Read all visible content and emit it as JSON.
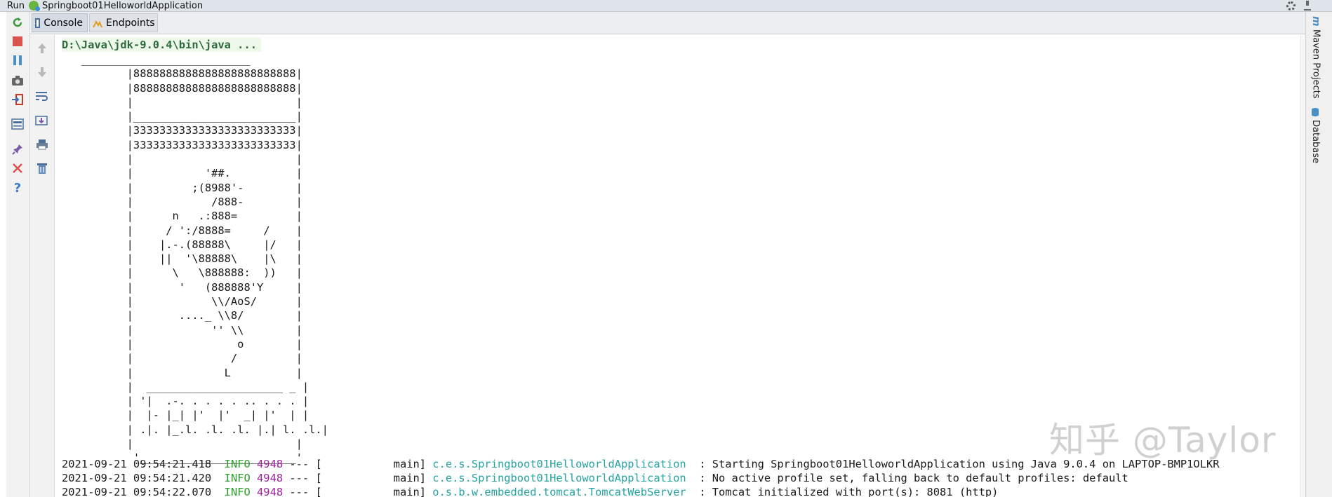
{
  "titlebar": {
    "run_label": "Run",
    "app_name": "Springboot01HelloworldApplication"
  },
  "tabs": [
    {
      "label": "Console",
      "icon": "console-icon",
      "active": true
    },
    {
      "label": "Endpoints",
      "icon": "endpoints-icon",
      "active": false
    }
  ],
  "left_toolbar": [
    "rerun-icon",
    "stop-icon",
    "pause-icon",
    "camera-icon",
    "exit-icon",
    "layout-icon",
    "pin-icon",
    "close-icon",
    "help-icon"
  ],
  "gutter_toolbar": [
    "up-arrow-icon",
    "down-arrow-icon",
    "soft-wrap-icon",
    "scroll-to-end-icon",
    "print-icon",
    "trash-icon"
  ],
  "right_bar": {
    "maven": "Maven Projects",
    "database": "Database"
  },
  "console": {
    "command": "D:\\Java\\jdk-9.0.4\\bin\\java ...",
    "banner": "   __________________________\n          |8888888888888888888888888|\n          |8888888888888888888888888|\n          |                         |\n          |_________________________|\n          |3333333333333333333333333|\n          |3333333333333333333333333|\n          |                         |\n          |           '##.          |\n          |         ;(8988'-        |\n          |            /888-        |\n          |      n   .:888=         |\n          |     / ':/8888=     /    |\n          |    |.-.(88888\\     |/   |\n          |    ||  '\\88888\\    |\\   |\n          |      \\   \\888888:  ))   |\n          |       '   (888888'Y     |\n          |            \\\\/AoS/      |\n          |       ...._ \\\\8/        |\n          |            '' \\\\        |\n          |                o        |\n          |               /         |\n          |              L          |\n          |  _____________________ _ |\n          | '|  .-. . . . . .. . . . |\n          |  |- |_| |'  |'  _| |'  | |\n          | .|. |_.l. .l. .l. |.| l. .l.|\n          |                         |\n           '________________________'",
    "log_lines": [
      {
        "date": "2021-09-21 09:54:21.418",
        "level": "INFO",
        "pid": "4948",
        "sep": "---",
        "thread": "[           main]",
        "logger": "c.e.s.Springboot01HelloworldApplication",
        "message": ": Starting Springboot01HelloworldApplication using Java 9.0.4 on LAPTOP-BMP1OLKR"
      },
      {
        "date": "2021-09-21 09:54:21.420",
        "level": "INFO",
        "pid": "4948",
        "sep": "---",
        "thread": "[           main]",
        "logger": "c.e.s.Springboot01HelloworldApplication",
        "message": ": No active profile set, falling back to default profiles: default"
      },
      {
        "date": "2021-09-21 09:54:22.070",
        "level": "INFO",
        "pid": "4948",
        "sep": "---",
        "thread": "[           main]",
        "logger": "o.s.b.w.embedded.tomcat.TomcatWebServer",
        "message": ": Tomcat initialized with port(s): 8081 (http)"
      }
    ]
  },
  "watermark": "知乎 @Taylor",
  "colors": {
    "info": "#2ca02c",
    "pid": "#a020a0",
    "logger": "#25a3a3",
    "command": "#2e6b3a"
  }
}
